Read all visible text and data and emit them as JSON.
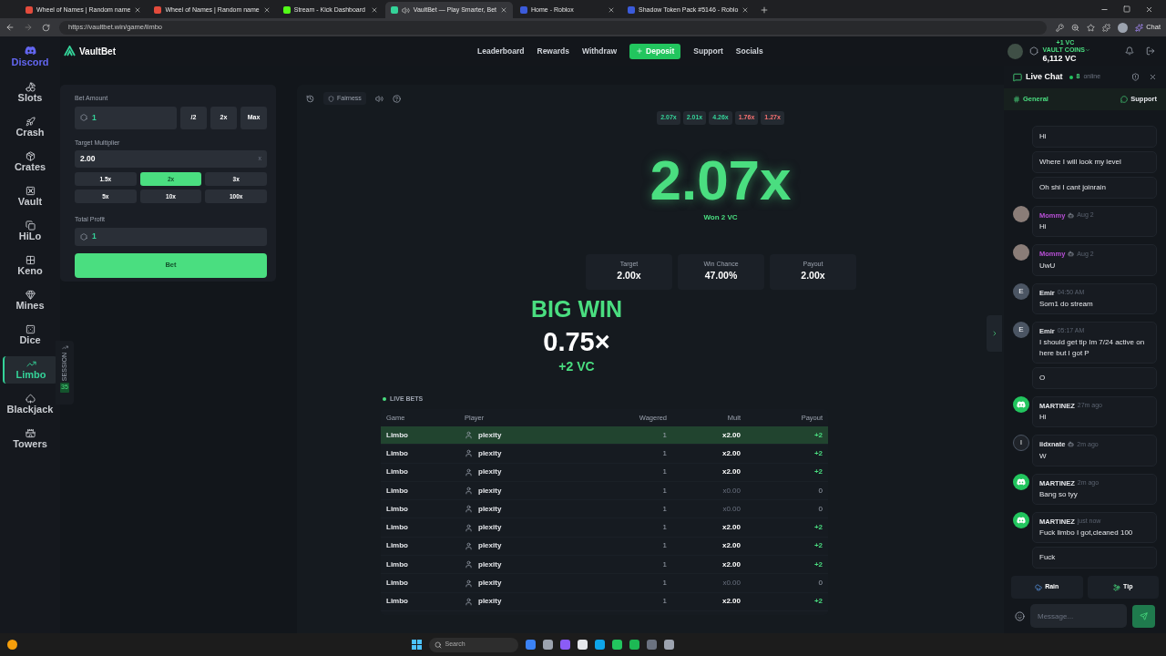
{
  "browser": {
    "tabs": [
      {
        "title": "Wheel of Names | Random name",
        "selected": false,
        "audio": false
      },
      {
        "title": "Wheel of Names | Random name",
        "selected": false,
        "audio": false
      },
      {
        "title": "Stream - Kick Dashboard",
        "selected": false,
        "audio": false
      },
      {
        "title": "VaultBet — Play Smarter, Bet",
        "selected": true,
        "audio": true
      },
      {
        "title": "Home - Roblox",
        "selected": false,
        "audio": false
      },
      {
        "title": "Shadow Token Pack #5146 - Roblo",
        "selected": false,
        "audio": false
      }
    ],
    "url": "https://vaultbet.win/game/limbo",
    "chat_button": "Chat"
  },
  "sidebar": {
    "discord": "Discord",
    "items": [
      {
        "label": "Slots",
        "selected": false
      },
      {
        "label": "Crash",
        "selected": false
      },
      {
        "label": "Crates",
        "selected": false
      },
      {
        "label": "Vault",
        "selected": false
      },
      {
        "label": "HiLo",
        "selected": false
      },
      {
        "label": "Keno",
        "selected": false
      },
      {
        "label": "Mines",
        "selected": false
      },
      {
        "label": "Dice",
        "selected": false
      },
      {
        "label": "Limbo",
        "selected": true
      },
      {
        "label": "Blackjack",
        "selected": false
      },
      {
        "label": "Towers",
        "selected": false
      }
    ],
    "session": {
      "label": "SESSION",
      "count": "35"
    }
  },
  "nav": {
    "logo": "VaultBet",
    "links": [
      {
        "label": "Leaderboard",
        "kind": "link"
      },
      {
        "label": "Rewards",
        "kind": "link"
      },
      {
        "label": "Withdraw",
        "kind": "link"
      },
      {
        "label": "Deposit",
        "kind": "primary"
      },
      {
        "label": "Support",
        "kind": "link"
      },
      {
        "label": "Socials",
        "kind": "link"
      }
    ],
    "wallet": {
      "delta": "+1 VC",
      "label": "VAULT COINS",
      "balance": "6,112 VC"
    }
  },
  "bet_panel": {
    "bet_amount": {
      "label": "Bet Amount",
      "value": "1",
      "buttons": [
        "/2",
        "2x",
        "Max"
      ]
    },
    "target": {
      "label": "Target Multiplier",
      "value": "2.00",
      "suffix": "x"
    },
    "presets": [
      {
        "label": "1.5x",
        "selected": false
      },
      {
        "label": "2x",
        "selected": true
      },
      {
        "label": "3x",
        "selected": false
      },
      {
        "label": "5x",
        "selected": false
      },
      {
        "label": "10x",
        "selected": false
      },
      {
        "label": "100x",
        "selected": false
      }
    ],
    "profit": {
      "label": "Total Profit",
      "value": "1"
    },
    "bet_button": "Bet"
  },
  "game": {
    "toolbar": {
      "fairness": "Fairness"
    },
    "history": [
      {
        "value": "2.07x",
        "win": true
      },
      {
        "value": "2.01x",
        "win": true
      },
      {
        "value": "4.26x",
        "win": true
      },
      {
        "value": "1.76x",
        "win": false
      },
      {
        "value": "1.27x",
        "win": false
      }
    ],
    "result": "2.07x",
    "result_note": "Won 2 VC",
    "stats": [
      {
        "label": "Target",
        "value": "2.00x"
      },
      {
        "label": "Win Chance",
        "value": "47.00%"
      },
      {
        "label": "Payout",
        "value": "2.00x"
      }
    ],
    "big_win": {
      "title": "BIG WIN",
      "multiplier": "0.75×",
      "amount": "+2 VC"
    }
  },
  "live_bets": {
    "title": "LIVE BETS",
    "columns": [
      "Game",
      "Player",
      "Wagered",
      "Mult",
      "Payout"
    ],
    "rows": [
      {
        "game": "Limbo",
        "player": "plexity",
        "wagered": "1",
        "mult": "x2.00",
        "payout": "+2",
        "win": true,
        "highlighted": true
      },
      {
        "game": "Limbo",
        "player": "plexity",
        "wagered": "1",
        "mult": "x2.00",
        "payout": "+2",
        "win": true,
        "highlighted": false
      },
      {
        "game": "Limbo",
        "player": "plexity",
        "wagered": "1",
        "mult": "x2.00",
        "payout": "+2",
        "win": true,
        "highlighted": false
      },
      {
        "game": "Limbo",
        "player": "plexity",
        "wagered": "1",
        "mult": "x0.00",
        "payout": "0",
        "win": false,
        "highlighted": false
      },
      {
        "game": "Limbo",
        "player": "plexity",
        "wagered": "1",
        "mult": "x0.00",
        "payout": "0",
        "win": false,
        "highlighted": false
      },
      {
        "game": "Limbo",
        "player": "plexity",
        "wagered": "1",
        "mult": "x2.00",
        "payout": "+2",
        "win": true,
        "highlighted": false
      },
      {
        "game": "Limbo",
        "player": "plexity",
        "wagered": "1",
        "mult": "x2.00",
        "payout": "+2",
        "win": true,
        "highlighted": false
      },
      {
        "game": "Limbo",
        "player": "plexity",
        "wagered": "1",
        "mult": "x2.00",
        "payout": "+2",
        "win": true,
        "highlighted": false
      },
      {
        "game": "Limbo",
        "player": "plexity",
        "wagered": "1",
        "mult": "x0.00",
        "payout": "0",
        "win": false,
        "highlighted": false
      },
      {
        "game": "Limbo",
        "player": "plexity",
        "wagered": "1",
        "mult": "x2.00",
        "payout": "+2",
        "win": true,
        "highlighted": false
      }
    ]
  },
  "chat": {
    "title": "Live Chat",
    "online_count": "8",
    "online_label": "online",
    "channels": [
      {
        "label": "General",
        "selected": true
      },
      {
        "label": "Support",
        "selected": false
      }
    ],
    "messages": [
      {
        "text": "Hi"
      },
      {
        "text": "Where I will look my level"
      },
      {
        "text": "Oh shi I cant joinrain"
      },
      {
        "author": {
          "name": "Mommy",
          "time": "Aug 2",
          "color": "#b84fd6",
          "badge": true,
          "avatar": {
            "kind": "photo"
          }
        },
        "text": "Hi"
      },
      {
        "author": {
          "name": "Mommy",
          "time": "Aug 2",
          "color": "#b84fd6",
          "badge": true,
          "avatar": {
            "kind": "photo"
          }
        },
        "text": "UwU"
      },
      {
        "author": {
          "name": "Emir",
          "time": "04:50 AM",
          "color": "#e5e7eb",
          "badge": false,
          "avatar": {
            "kind": "letter",
            "letter": "E"
          }
        },
        "text": "Som1 do stream"
      },
      {
        "author": {
          "name": "Emir",
          "time": "05:17 AM",
          "color": "#e5e7eb",
          "badge": false,
          "avatar": {
            "kind": "letter",
            "letter": "E"
          }
        },
        "text": "I should get tip Im 7/24 active on here but I got P"
      },
      {
        "text": "O"
      },
      {
        "author": {
          "name": "MARTINEZ",
          "time": "27m ago",
          "color": "#e5e7eb",
          "badge": false,
          "avatar": {
            "kind": "discord"
          }
        },
        "text": "Hi"
      },
      {
        "author": {
          "name": "iidxnate",
          "time": "2m ago",
          "color": "#e5e7eb",
          "badge": true,
          "avatar": {
            "kind": "ring",
            "letter": "I"
          }
        },
        "text": "W"
      },
      {
        "author": {
          "name": "MARTINEZ",
          "time": "2m ago",
          "color": "#e5e7eb",
          "badge": false,
          "avatar": {
            "kind": "discord"
          }
        },
        "text": "Bang so tyy"
      },
      {
        "author": {
          "name": "MARTINEZ",
          "time": "just now",
          "color": "#e5e7eb",
          "badge": false,
          "avatar": {
            "kind": "discord"
          }
        },
        "text": "Fuck limbo I got,cleaned 100"
      },
      {
        "text": "Fuck"
      }
    ],
    "rain": "Rain",
    "tip": "Tip",
    "input_placeholder": "Message..."
  },
  "taskbar": {
    "search_placeholder": "Search"
  }
}
